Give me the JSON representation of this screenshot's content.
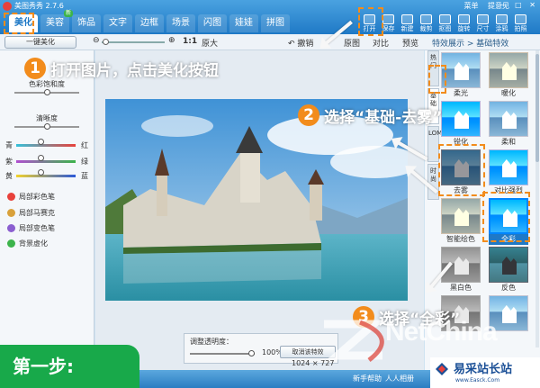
{
  "app": {
    "title": "美图秀秀 2.7.6",
    "top_links": [
      "菜单",
      "提意见"
    ],
    "window_controls": "— □ ✕"
  },
  "nav_tabs": [
    {
      "label": "美化",
      "active": true
    },
    {
      "label": "美容",
      "badge": "新"
    },
    {
      "label": "饰品"
    },
    {
      "label": "文字"
    },
    {
      "label": "边框"
    },
    {
      "label": "场景"
    },
    {
      "label": "闪图"
    },
    {
      "label": "娃娃"
    },
    {
      "label": "拼图"
    }
  ],
  "top_tools": [
    "打开",
    "保存",
    "新建",
    "裁剪",
    "抠图",
    "旋转",
    "尺寸",
    "涂鸦",
    "拍照"
  ],
  "toolbar": {
    "onekey_label": "一键美化",
    "zoom_minus": "⊖",
    "zoom_plus": "⊕",
    "ratio": "1:1",
    "original_size": "原大",
    "undo": "↶ 撤销",
    "orig_image": "原图",
    "compare": "对比",
    "preview": "预览",
    "breadcrumb": "特效展示 > 基础特效"
  },
  "left_panel": {
    "sliders": [
      {
        "label": "色彩饱和度",
        "value": 0.5
      },
      {
        "label": "清晰度",
        "value": 0.5
      }
    ],
    "color_sliders": [
      {
        "left": "青",
        "right": "红",
        "color_a": "#35c0d9",
        "color_b": "#e8413b",
        "value": 0.5
      },
      {
        "left": "紫",
        "right": "绿",
        "color_a": "#b04fd0",
        "color_b": "#3cb44b",
        "value": 0.5
      },
      {
        "left": "黄",
        "right": "蓝",
        "color_a": "#f2d22b",
        "color_b": "#2b59d8",
        "value": 0.5
      }
    ],
    "brushes": [
      {
        "label": "局部彩色笔",
        "color": "#e8413b"
      },
      {
        "label": "局部马赛克",
        "color": "#d9a13b"
      },
      {
        "label": "局部变色笔",
        "color": "#8b5fd0"
      },
      {
        "label": "背景虚化",
        "color": "#3cb44b"
      }
    ]
  },
  "canvas": {
    "opacity_label": "调整透明度：",
    "opacity_value": "100%",
    "opacity_level": 1.0,
    "cancel_effect": "取消该特效",
    "image_size": "1024 × 727"
  },
  "right_panel": {
    "side_tabs": [
      "热门",
      "基础",
      "LOMO",
      "时尚"
    ],
    "effects": [
      {
        "label": "柔光",
        "style": "soft"
      },
      {
        "label": "暖化",
        "style": "warm"
      },
      {
        "label": "锐化",
        "style": "strong"
      },
      {
        "label": "柔和",
        "style": "soft"
      },
      {
        "label": "去雾",
        "style": "dark"
      },
      {
        "label": "对比强烈",
        "style": "strong"
      },
      {
        "label": "智能绘色",
        "style": "warm"
      },
      {
        "label": "全彩",
        "style": "strong",
        "selected": true
      },
      {
        "label": "黑白色",
        "style": "gray"
      },
      {
        "label": "反色",
        "style": "inverse"
      },
      {
        "label": "",
        "style": "gray"
      },
      {
        "label": "",
        "style": "soft"
      }
    ]
  },
  "bottom": {
    "step_text": "第一步:",
    "help": "新手帮助",
    "community": "人人相册"
  },
  "annotations": {
    "step1_num": "1",
    "step1_text": "打开图片，点击美化按钮",
    "step2_num": "2",
    "step2_text": "选择“基础-去雾”",
    "step3_num": "3",
    "step3_text": "选择“全彩”"
  },
  "watermarks": {
    "zd_text": "NetChina",
    "site_name": "易采站长站",
    "site_url": "www.Easck.Com"
  }
}
